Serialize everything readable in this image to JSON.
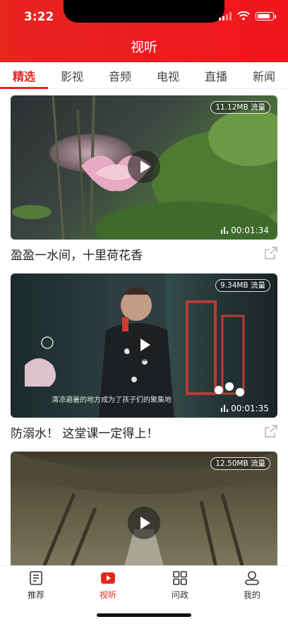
{
  "status_bar": {
    "time": "3:22"
  },
  "header": {
    "title": "视听"
  },
  "tabs": [
    {
      "label": "精选",
      "active": true
    },
    {
      "label": "影视",
      "active": false
    },
    {
      "label": "音频",
      "active": false
    },
    {
      "label": "电视",
      "active": false
    },
    {
      "label": "直播",
      "active": false
    },
    {
      "label": "新闻",
      "active": false
    }
  ],
  "videos": [
    {
      "title": "盈盈一水间，十里荷花香",
      "size": "11.12MB 流量",
      "duration": "00:01:34"
    },
    {
      "title": "防溺水！ 这堂课一定得上！",
      "size": "9.34MB 流量",
      "duration": "00:01:35",
      "subtitle_overlay": "清凉避暑的地方成为了孩子们的聚集地"
    },
    {
      "title": "",
      "size": "12.50MB 流量",
      "duration": ""
    }
  ],
  "bottom_nav": [
    {
      "label": "推荐",
      "icon": "document-icon",
      "active": false
    },
    {
      "label": "视听",
      "icon": "play-video-icon",
      "active": true
    },
    {
      "label": "问政",
      "icon": "grid-icon",
      "active": false
    },
    {
      "label": "我的",
      "icon": "user-icon",
      "active": false
    }
  ],
  "colors": {
    "accent": "#e52520",
    "header": "#ee1c1f"
  }
}
